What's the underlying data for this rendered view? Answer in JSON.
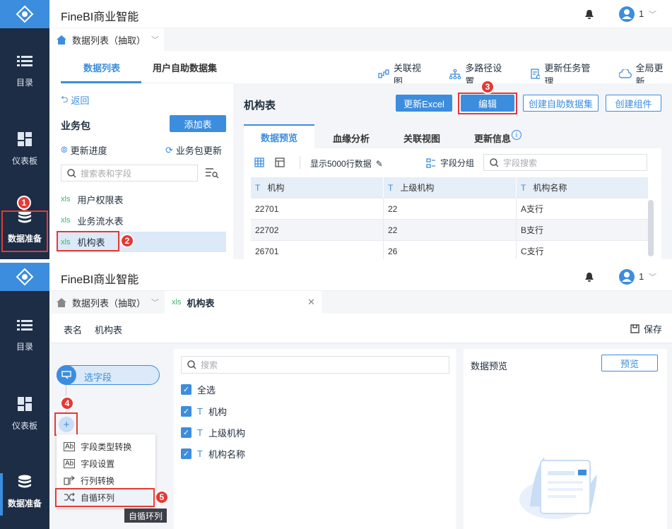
{
  "app": {
    "title": "FineBI商业智能",
    "user": "1",
    "chevron": "﹀"
  },
  "nav": [
    {
      "label": "目录"
    },
    {
      "label": "仪表板"
    },
    {
      "label": "数据准备"
    }
  ],
  "p1": {
    "tab": "数据列表（抽取）",
    "left_tabs": [
      "数据列表",
      "用户自助数据集"
    ],
    "toolbar": [
      "关联视图",
      "多路径设置",
      "更新任务管理",
      "全局更新"
    ],
    "back": "返回",
    "package": "业务包",
    "add_table": "添加表",
    "update_progress": "更新进度",
    "package_update": "业务包更新",
    "search_placeholder": "搜索表和字段",
    "tables": [
      "用户权限表",
      "业务流水表",
      "机构表"
    ],
    "table_title": "机构表",
    "buttons": [
      "更新Excel",
      "编辑",
      "创建自助数据集",
      "创建组件"
    ],
    "detail_tabs": [
      "数据预览",
      "血缘分析",
      "关联视图",
      "更新信息"
    ],
    "show_rows": "显示5000行数据",
    "field_group": "字段分组",
    "field_search": "字段搜索",
    "columns": [
      "机构",
      "上级机构",
      "机构名称"
    ],
    "rows": [
      [
        "22701",
        "22",
        "A支行"
      ],
      [
        "22702",
        "22",
        "B支行"
      ],
      [
        "26701",
        "26",
        "C支行"
      ]
    ]
  },
  "p2": {
    "tab_prev": "数据列表（抽取）",
    "tab_cur": "机构表",
    "table_name_label": "表名",
    "table_name": "机构表",
    "save": "保存",
    "step": "选字段",
    "plus": "+",
    "menu": [
      "字段类型转换",
      "字段设置",
      "行列转换",
      "自循环列"
    ],
    "tooltip": "自循环列",
    "search": "搜索",
    "select_all": "全选",
    "fields": [
      "机构",
      "上级机构",
      "机构名称"
    ],
    "preview_title": "数据预览",
    "preview_btn": "预览"
  },
  "badges": [
    "1",
    "2",
    "3",
    "4",
    "5"
  ],
  "colors": {
    "accent": "#3c8dde",
    "sidebar": "#1d2d45",
    "marker": "#e53935"
  }
}
